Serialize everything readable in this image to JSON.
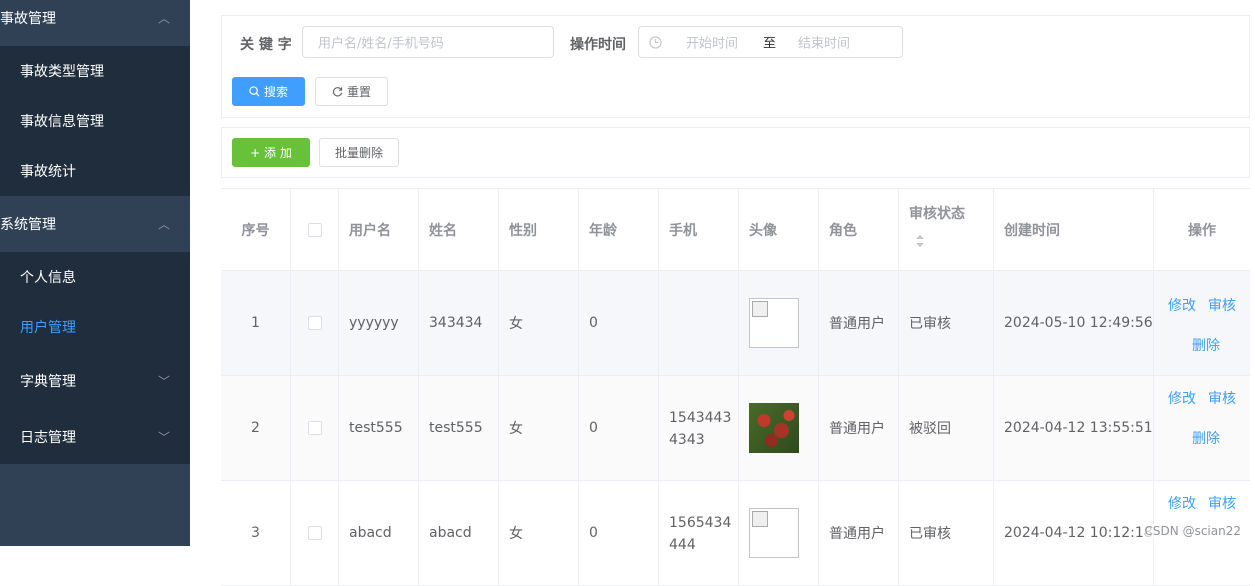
{
  "sidebar": {
    "groups": [
      {
        "label": "事故管理",
        "arrow": "︿"
      },
      {
        "label": "系统管理",
        "arrow": "︿"
      }
    ],
    "accident_items": [
      {
        "label": "事故类型管理"
      },
      {
        "label": "事故信息管理"
      },
      {
        "label": "事故统计"
      }
    ],
    "system_items": [
      {
        "label": "个人信息"
      },
      {
        "label": "用户管理"
      },
      {
        "label": "字典管理",
        "arrow": "﹀"
      },
      {
        "label": "日志管理",
        "arrow": "﹀"
      }
    ],
    "active_color": "#409eff"
  },
  "search": {
    "keyword_label": "关 键 字",
    "keyword_placeholder": "用户名/姓名/手机号码",
    "time_label": "操作时间",
    "start_placeholder": "开始时间",
    "separator": "至",
    "end_placeholder": "结束时间",
    "search_button": "搜索",
    "reset_button": "重置"
  },
  "toolbar": {
    "add_button": "+ 添 加",
    "batch_delete_button": "批量删除"
  },
  "table": {
    "headers": [
      "序号",
      "",
      "用户名",
      "姓名",
      "性别",
      "年龄",
      "手机",
      "头像",
      "角色",
      "审核状态",
      "创建时间",
      "操作"
    ],
    "rows": [
      {
        "index": "1",
        "username": "yyyyyy",
        "name": "343434",
        "gender": "女",
        "age": "0",
        "phone_line1": "",
        "phone_line2": "",
        "avatar": "broken-image",
        "role": "普通用户",
        "status": "已审核",
        "created": "2024-05-10 12:49:56",
        "edit": "修改",
        "audit": "审核",
        "delete": "删除"
      },
      {
        "index": "2",
        "username": "test555",
        "name": "test555",
        "gender": "女",
        "age": "0",
        "phone_line1": "1543443",
        "phone_line2": "4343",
        "avatar": "cherries-photo",
        "role": "普通用户",
        "status": "被驳回",
        "created": "2024-04-12 13:55:51",
        "edit": "修改",
        "audit": "审核",
        "delete": "删除"
      },
      {
        "index": "3",
        "username": "abacd",
        "name": "abacd",
        "gender": "女",
        "age": "0",
        "phone_line1": "1565434",
        "phone_line2": "444",
        "avatar": "broken-image",
        "role": "普通用户",
        "status": "已审核",
        "created": "2024-04-12 10:12:18",
        "edit": "修改",
        "audit": "审核",
        "delete": ""
      }
    ]
  },
  "watermark": "CSDN @scian22"
}
